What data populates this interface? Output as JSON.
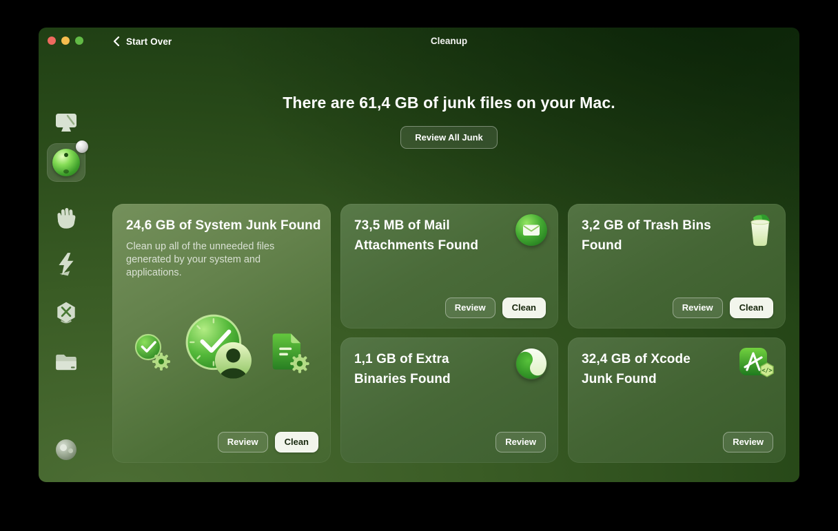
{
  "window": {
    "back_label": "Start Over",
    "title": "Cleanup"
  },
  "hero": {
    "heading": "There are 61,4 GB of junk files on your Mac.",
    "review_all_label": "Review All Junk"
  },
  "sidebar": {
    "items": [
      {
        "id": "smart-scan",
        "icon": "mac-display-icon",
        "selected": false
      },
      {
        "id": "cleanup",
        "icon": "cleanup-ball-icon",
        "selected": true,
        "badge": true
      },
      {
        "id": "protection",
        "icon": "hand-icon",
        "selected": false
      },
      {
        "id": "performance",
        "icon": "lightning-icon",
        "selected": false
      },
      {
        "id": "applications",
        "icon": "hexagon-x-icon",
        "selected": false
      },
      {
        "id": "files",
        "icon": "folder-icon",
        "selected": false
      }
    ],
    "assistant_icon": "sphere-dots-icon"
  },
  "cards": [
    {
      "title": "24,6 GB of System Junk Found",
      "description": "Clean up all of the unneeded files generated by your system and applications.",
      "icons": [
        "clock-gear-icon",
        "clock-user-icon",
        "document-gear-icon"
      ],
      "review_label": "Review",
      "clean_label": "Clean"
    },
    {
      "title": "73,5 MB of Mail Attachments Found",
      "icon": "mail-envelope-icon",
      "review_label": "Review",
      "clean_label": "Clean"
    },
    {
      "title": "3,2 GB of Trash Bins Found",
      "icon": "trash-bin-icon",
      "review_label": "Review",
      "clean_label": "Clean"
    },
    {
      "title": "1,1 GB of Extra Binaries Found",
      "icon": "yin-yang-circle-icon",
      "review_label": "Review"
    },
    {
      "title": "32,4 GB of Xcode Junk Found",
      "icon": "xcode-hammer-icon",
      "review_label": "Review"
    }
  ],
  "colors": {
    "traffic_red": "#ee6a5f",
    "traffic_yellow": "#f5bd4e",
    "traffic_green": "#62ba46",
    "accent_green": "#2e8b24",
    "clean_button_bg": "#f2f5ec",
    "clean_button_text": "#17270d",
    "window_dark": "#173510",
    "window_light": "#4c6d34"
  }
}
